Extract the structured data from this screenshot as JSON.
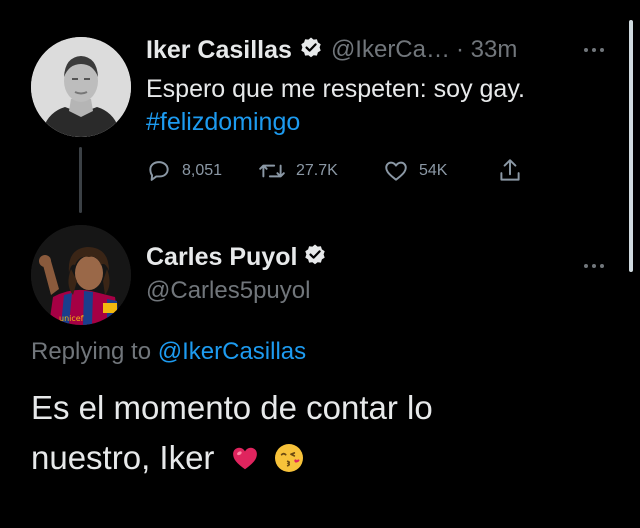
{
  "tweet1": {
    "name": "Iker Casillas",
    "handle": "@IkerCa…",
    "time": "· 33m",
    "text": "Espero que me respeten: soy gay.",
    "hashtag": "#felizdomingo",
    "replies": "8,051",
    "retweets": "27.7K",
    "likes": "54K"
  },
  "tweet2": {
    "name": "Carles Puyol",
    "handle": "@Carles5puyol",
    "replying_label": "Replying to",
    "replying_to": "@IkerCasillas",
    "text_line1": "Es el momento de contar lo",
    "text_line2": "nuestro, Iker",
    "emoji1": "❤️",
    "emoji2": "😘"
  },
  "icons": [
    "verified-badge-icon",
    "reply-icon",
    "retweet-icon",
    "like-icon",
    "share-icon",
    "more-icon"
  ],
  "colors": {
    "background": "#000000",
    "text": "#e7e9ea",
    "muted": "#71767b",
    "link": "#1d9bf0"
  }
}
